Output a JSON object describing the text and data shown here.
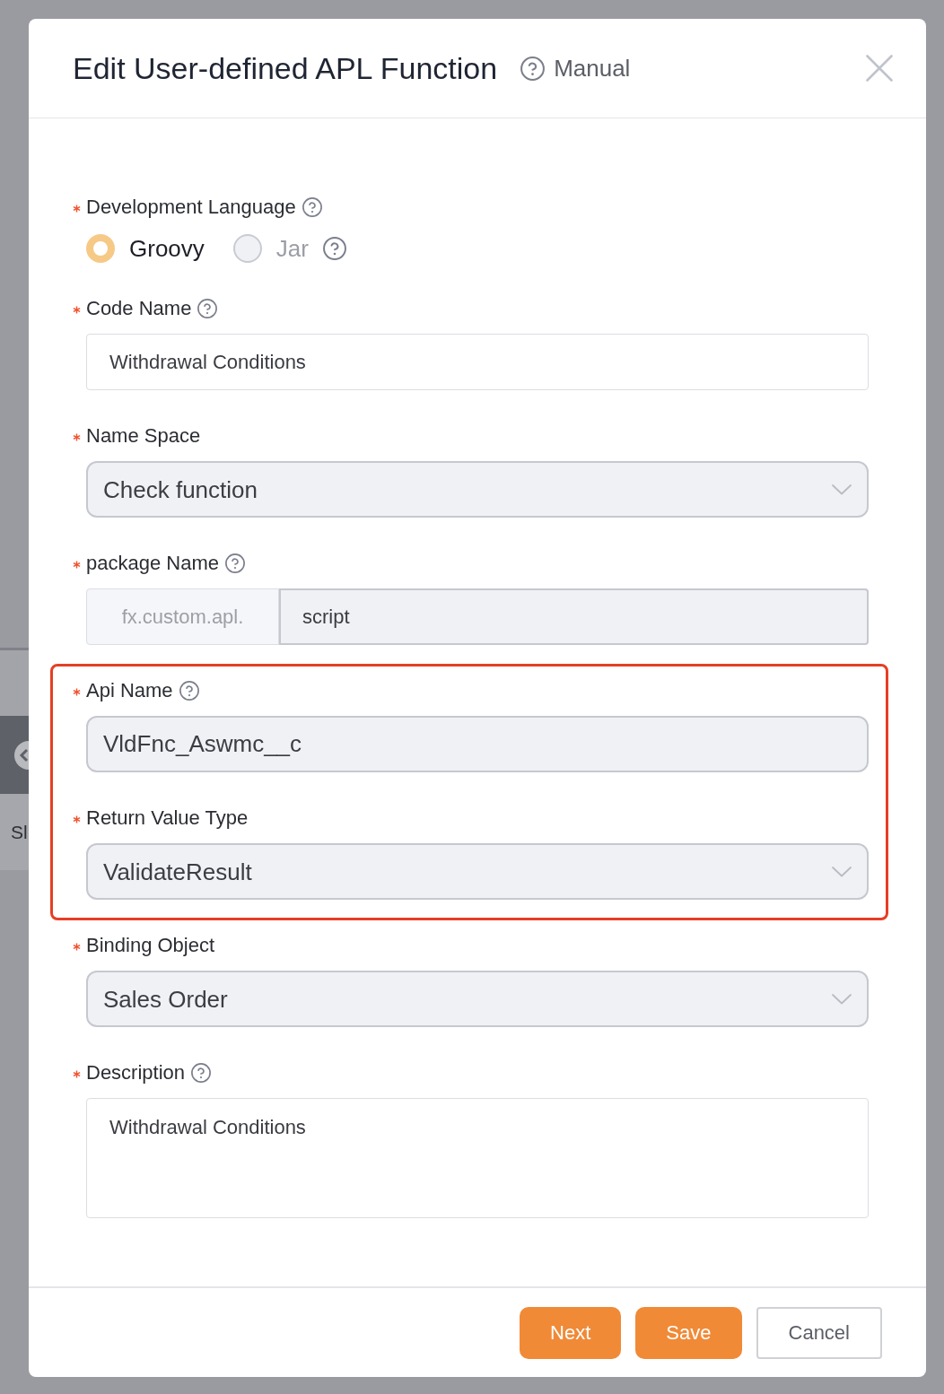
{
  "dialog": {
    "title": "Edit User-defined APL Function",
    "manual_link": "Manual"
  },
  "background": {
    "text": "Sl"
  },
  "fields": [
    {
      "kind": "radio",
      "label": "Development Language",
      "required": true,
      "help": true,
      "highlighted": false,
      "options": [
        {
          "label": "Groovy",
          "selected": true,
          "disabled": false,
          "help": false
        },
        {
          "label": "Jar",
          "selected": false,
          "disabled": true,
          "help": true
        }
      ]
    },
    {
      "kind": "text",
      "label": "Code Name",
      "required": true,
      "help": true,
      "highlighted": false,
      "disabled": false,
      "value": "Withdrawal Conditions"
    },
    {
      "kind": "select",
      "label": "Name Space",
      "required": true,
      "help": false,
      "highlighted": false,
      "disabled": true,
      "value": "Check function"
    },
    {
      "kind": "prefixed",
      "label": "package Name",
      "required": true,
      "help": true,
      "highlighted": false,
      "disabled": true,
      "prefix": "fx.custom.apl.",
      "value": "script"
    },
    {
      "kind": "text",
      "label": "Api Name",
      "required": true,
      "help": true,
      "highlighted": true,
      "disabled": true,
      "value": "VldFnc_Aswmc__c"
    },
    {
      "kind": "select",
      "label": "Return Value Type",
      "required": true,
      "help": false,
      "highlighted": true,
      "disabled": true,
      "value": "ValidateResult"
    },
    {
      "kind": "select",
      "label": "Binding Object",
      "required": true,
      "help": false,
      "highlighted": false,
      "disabled": true,
      "value": "Sales Order"
    },
    {
      "kind": "textarea",
      "label": "Description",
      "required": true,
      "help": true,
      "highlighted": false,
      "disabled": false,
      "value": "Withdrawal Conditions"
    }
  ],
  "buttons": [
    {
      "label": "Next",
      "kind": "primary"
    },
    {
      "label": "Save",
      "kind": "primary"
    },
    {
      "label": "Cancel",
      "kind": "default"
    }
  ]
}
